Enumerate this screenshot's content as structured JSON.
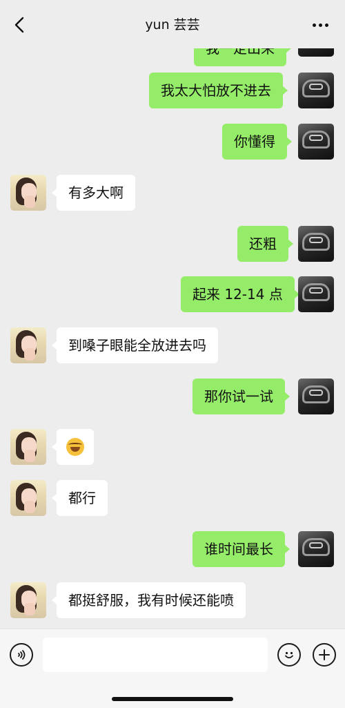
{
  "header": {
    "title": "yun 芸芸"
  },
  "messages": {
    "m0": {
      "text": "我一定出来"
    },
    "m1": {
      "text": "我太大怕放不进去"
    },
    "m2": {
      "text": "你懂得"
    },
    "m3": {
      "text": "有多大啊"
    },
    "m4": {
      "text": "还粗"
    },
    "m5": {
      "text": "起来 12-14 点"
    },
    "m6": {
      "text": "到嗓子眼能全放进去吗"
    },
    "m7": {
      "text": "那你试一试"
    },
    "m8": {
      "emoji": "laughing-crying-emoji"
    },
    "m9": {
      "text": "都行"
    },
    "m10": {
      "text": "谁时间最长"
    },
    "m11": {
      "text": "都挺舒服，我有时候还能喷"
    }
  },
  "colors": {
    "background": "#ededed",
    "outgoing_bubble": "#95ec69",
    "incoming_bubble": "#ffffff"
  },
  "input": {
    "value": "",
    "placeholder": ""
  }
}
